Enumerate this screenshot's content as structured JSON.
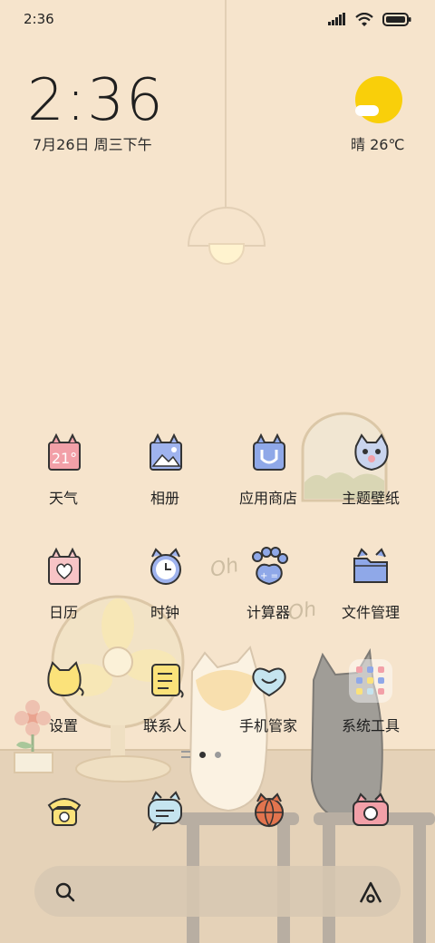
{
  "status_bar": {
    "time": "2:36",
    "icons": [
      "signal-icon",
      "wifi-icon",
      "battery-icon"
    ]
  },
  "clock_widget": {
    "time": "2:36",
    "date": "7月26日 周三下午"
  },
  "weather_widget": {
    "text": "晴 26℃",
    "icon": "sunny-cloud-icon"
  },
  "apps": [
    {
      "label": "天气",
      "icon": "weather-calendar-icon"
    },
    {
      "label": "相册",
      "icon": "gallery-icon"
    },
    {
      "label": "应用商店",
      "icon": "app-store-icon"
    },
    {
      "label": "主题壁纸",
      "icon": "theme-paw-icon"
    },
    {
      "label": "日历",
      "icon": "calendar-heart-icon"
    },
    {
      "label": "时钟",
      "icon": "clock-icon"
    },
    {
      "label": "计算器",
      "icon": "calculator-paw-icon"
    },
    {
      "label": "文件管理",
      "icon": "folder-icon"
    },
    {
      "label": "设置",
      "icon": "settings-cat-icon"
    },
    {
      "label": "联系人",
      "icon": "contacts-icon"
    },
    {
      "label": "手机管家",
      "icon": "security-heart-icon"
    },
    {
      "label": "系统工具",
      "icon": "tools-folder-icon"
    }
  ],
  "dock": [
    {
      "icon": "phone-icon"
    },
    {
      "icon": "messages-icon"
    },
    {
      "icon": "browser-icon"
    },
    {
      "icon": "camera-icon"
    }
  ],
  "page_indicator": {
    "pages": 2,
    "active": 1
  },
  "decor_text": [
    "Oh",
    "Oh"
  ],
  "colors": {
    "background": "#f6e4cc",
    "sun": "#f9cf0a",
    "icon_blue": "#8fa8e8",
    "icon_pink": "#f2a0a8",
    "icon_yellow": "#fbe27a"
  }
}
